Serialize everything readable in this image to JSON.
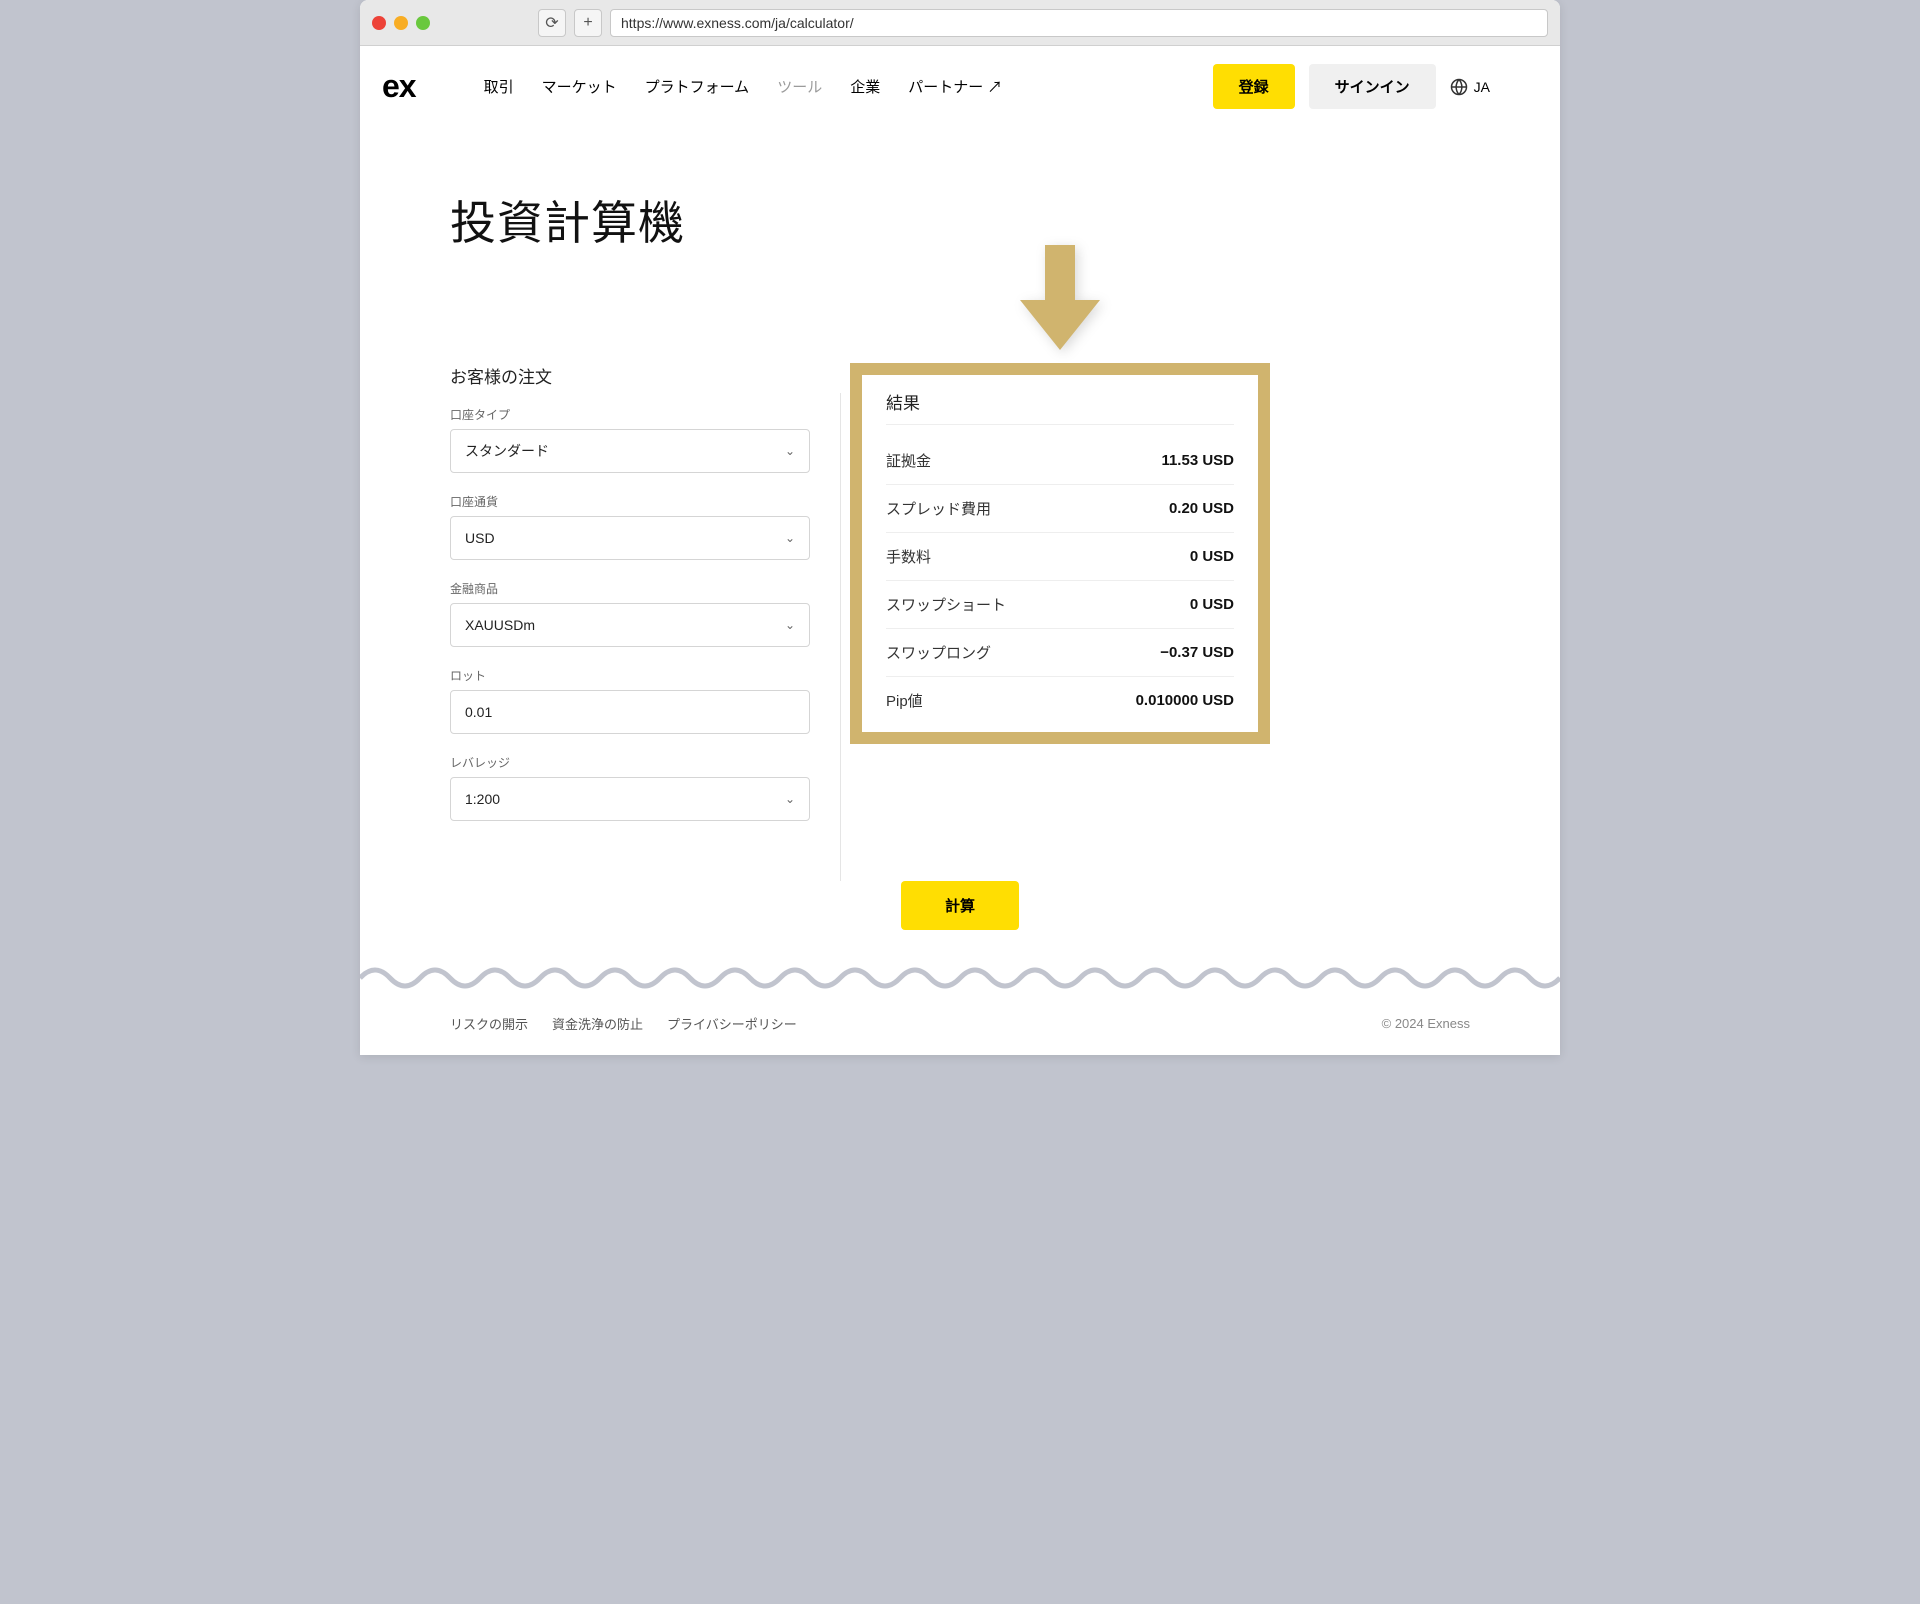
{
  "browser": {
    "url": "https://www.exness.com/ja/calculator/"
  },
  "header": {
    "logo": "ex",
    "nav": [
      {
        "label": "取引",
        "active": false
      },
      {
        "label": "マーケット",
        "active": false
      },
      {
        "label": "プラトフォーム",
        "active": false
      },
      {
        "label": "ツール",
        "active": true
      },
      {
        "label": "企業",
        "active": false
      },
      {
        "label": "パートナー ↗",
        "active": false
      }
    ],
    "register": "登録",
    "signin": "サインイン",
    "lang": "JA"
  },
  "page": {
    "title": "投資計算機"
  },
  "order": {
    "title": "お客様の注文",
    "fields": {
      "account_type": {
        "label": "口座タイプ",
        "value": "スタンダード"
      },
      "currency": {
        "label": "口座通貨",
        "value": "USD"
      },
      "instrument": {
        "label": "金融商品",
        "value": "XAUUSDm"
      },
      "lot": {
        "label": "ロット",
        "value": "0.01"
      },
      "leverage": {
        "label": "レバレッジ",
        "value": "1:200"
      }
    }
  },
  "results": {
    "title": "結果",
    "rows": [
      {
        "label": "証拠金",
        "value": "11.53 USD"
      },
      {
        "label": "スプレッド費用",
        "value": "0.20 USD"
      },
      {
        "label": "手数料",
        "value": "0 USD"
      },
      {
        "label": "スワップショート",
        "value": "0 USD"
      },
      {
        "label": "スワップロング",
        "value": "−0.37 USD"
      },
      {
        "label": "Pip値",
        "value": "0.010000 USD"
      }
    ]
  },
  "actions": {
    "calculate": "計算"
  },
  "footer": {
    "links": [
      "リスクの開示",
      "資金洗浄の防止",
      "プライバシーポリシー"
    ],
    "copyright": "© 2024 Exness"
  }
}
